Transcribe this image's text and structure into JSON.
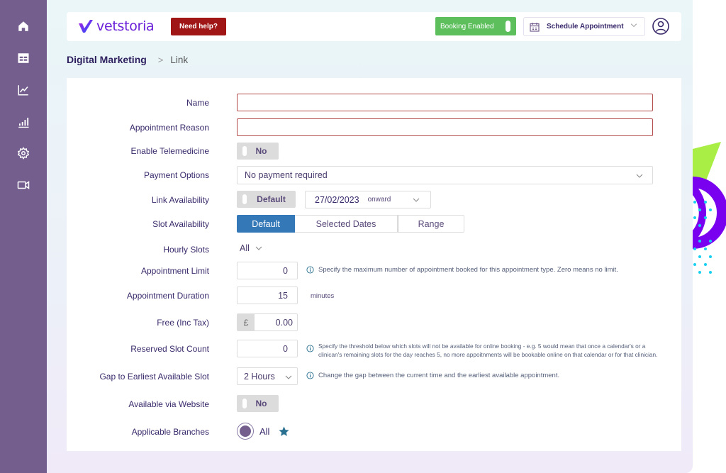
{
  "sidebar": {
    "items": [
      {
        "name": "home",
        "icon": "home-icon"
      },
      {
        "name": "calendar",
        "icon": "calendar-grid-icon"
      },
      {
        "name": "analytics",
        "icon": "line-chart-icon"
      },
      {
        "name": "reports",
        "icon": "bar-chart-icon"
      },
      {
        "name": "settings",
        "icon": "gear-icon"
      },
      {
        "name": "video",
        "icon": "video-camera-icon"
      }
    ]
  },
  "header": {
    "logo_text": "vetstoria",
    "help_label": "Need help?",
    "booking_label": "Booking Enabled",
    "schedule_label": "Schedule Appointment"
  },
  "breadcrumb": {
    "root": "Digital Marketing",
    "separator": ">",
    "current": "Link"
  },
  "form": {
    "name": {
      "label": "Name",
      "value": ""
    },
    "appointment_reason": {
      "label": "Appointment Reason",
      "value": ""
    },
    "enable_telemedicine": {
      "label": "Enable Telemedicine",
      "value": "No"
    },
    "payment_options": {
      "label": "Payment Options",
      "value": "No payment required"
    },
    "link_availability": {
      "label": "Link Availability",
      "toggle": "Default",
      "date": "27/02/2023",
      "suffix": "onward"
    },
    "slot_availability": {
      "label": "Slot Availability",
      "options": [
        "Default",
        "Selected Dates",
        "Range"
      ],
      "selected": "Default"
    },
    "hourly_slots": {
      "label": "Hourly Slots",
      "value": "All"
    },
    "appointment_limit": {
      "label": "Appointment Limit",
      "value": "0",
      "hint": "Specify the maximum  number of appointment booked for this appointment type. Zero means no limit."
    },
    "appointment_duration": {
      "label": "Appointment Duration",
      "value": "15",
      "unit": "minutes"
    },
    "fee": {
      "label": "Free (Inc Tax)",
      "currency": "£",
      "value": "0.00"
    },
    "reserved_slot_count": {
      "label": "Reserved Slot Count",
      "value": "0",
      "hint": "Specify the threshold below which slots will not be available for online booking - e.g. 5 would mean that once a calendar's or a clinican's remaining slots for the day reaches 5, no more appoitnments will be bookable online on that calendar or for that clinician."
    },
    "gap_earliest": {
      "label": "Gap to Earliest Available Slot",
      "value": "2 Hours",
      "hint": "Change the gap between the current time and the earliest available appointment."
    },
    "available_via_website": {
      "label": "Available via Website",
      "value": "No"
    },
    "applicable_branches": {
      "label": "Applicable Branches",
      "value": "All"
    }
  },
  "colors": {
    "sidebar": "#735e8e",
    "help": "#a01515",
    "booking": "#5cbf5c",
    "active_segment": "#3478b8",
    "required_border": "#b44b4b",
    "star": "#2a7090"
  }
}
